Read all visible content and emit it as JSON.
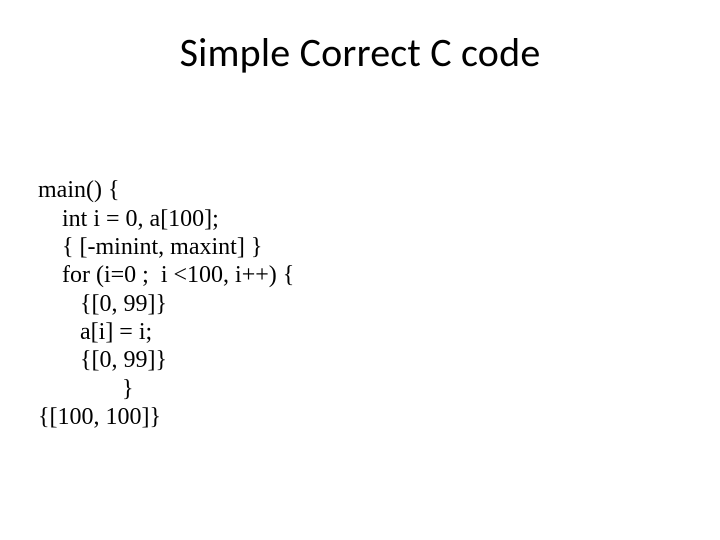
{
  "title": "Simple Correct C code",
  "code": {
    "l1": "main() {",
    "l2": "    int i = 0, a[100];",
    "l3": "    { [-minint, maxint] }",
    "l4": "    for (i=0 ;  i <100, i++) {",
    "l5": "       {[0, 99]}",
    "l6": "       a[i] = i;",
    "l7": "       {[0, 99]}",
    "l8": "              }",
    "l9": "{[100, 100]}"
  }
}
